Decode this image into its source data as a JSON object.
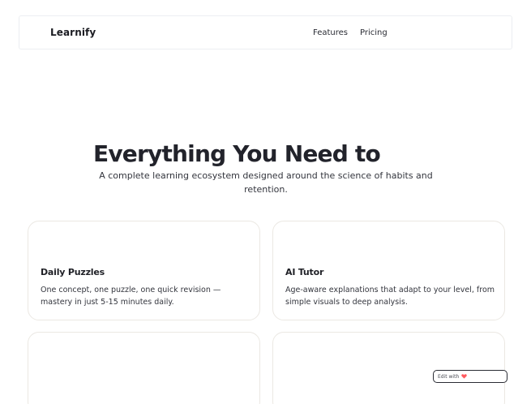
{
  "header": {
    "brand": "Learnify",
    "nav": [
      {
        "label": "Features"
      },
      {
        "label": "Pricing"
      }
    ]
  },
  "hero": {
    "title": "Everything You Need to",
    "subtitle": "A complete learning ecosystem designed around the science of habits and retention."
  },
  "features": [
    {
      "title": "Daily Puzzles",
      "description": "One concept, one puzzle, one quick revision — mastery in just 5-15 minutes daily."
    },
    {
      "title": "AI Tutor",
      "description": "Age-aware explanations that adapt to your level, from simple visuals to deep analysis."
    },
    {
      "title": "",
      "description": ""
    },
    {
      "title": "",
      "description": ""
    }
  ],
  "badge": {
    "label": "Edit with",
    "icon": "heart-icon",
    "accent": "#ff5a5f"
  }
}
